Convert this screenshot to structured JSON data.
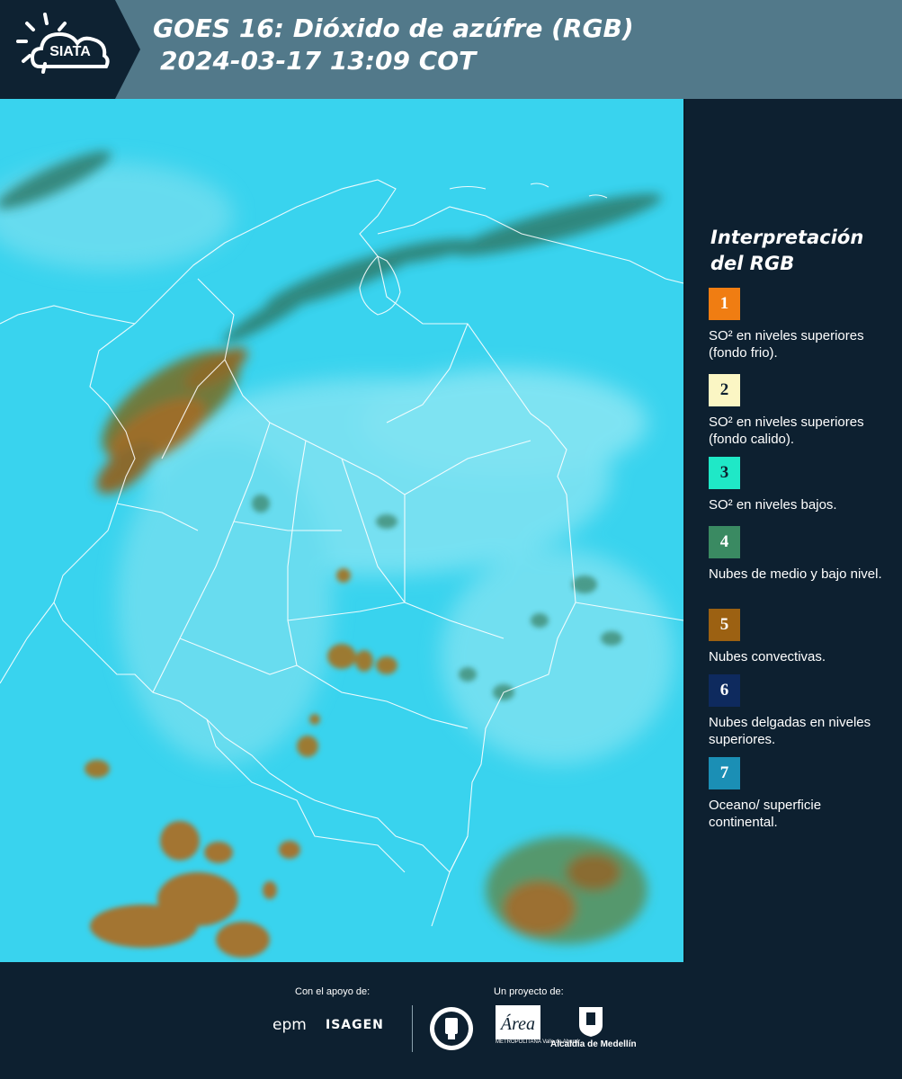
{
  "header": {
    "logo_text": "SIATA",
    "title": "GOES 16: Dióxido de azúfre (RGB)",
    "datetime": "2024-03-17 13:09 COT"
  },
  "legend": {
    "title": "Interpretación del RGB",
    "items": [
      {
        "number": "1",
        "color": "#f07d12",
        "label": "SO² en niveles superiores (fondo frio)."
      },
      {
        "number": "2",
        "color": "#fbf6c4",
        "label": "SO² en niveles superiores (fondo calido)."
      },
      {
        "number": "3",
        "color": "#1fe8c7",
        "label": "SO² en niveles bajos."
      },
      {
        "number": "4",
        "color": "#3a8a62",
        "label": "Nubes de medio y bajo nivel."
      },
      {
        "number": "5",
        "color": "#9c6112",
        "label": "Nubes convectivas."
      },
      {
        "number": "6",
        "color": "#0e2a5e",
        "label": "Nubes delgadas en niveles superiores."
      },
      {
        "number": "7",
        "color": "#1b8fb5",
        "label": "Oceano/ superficie continental."
      }
    ]
  },
  "footer": {
    "support_caption": "Con el apoyo de:",
    "project_caption": "Un proyecto de:",
    "sponsor_1": "epm",
    "sponsor_2": "ISAGEN",
    "partner_area": "Área",
    "partner_area_sub": "METROPOLITANA Valle de Aburrá",
    "partner_alcaldia": "Alcaldía de Medellín"
  },
  "map_colors": {
    "background": "#39d3ee",
    "convective": "#9c6e2a",
    "midlevel": "#3f8a72",
    "borders": "#ffffff"
  }
}
